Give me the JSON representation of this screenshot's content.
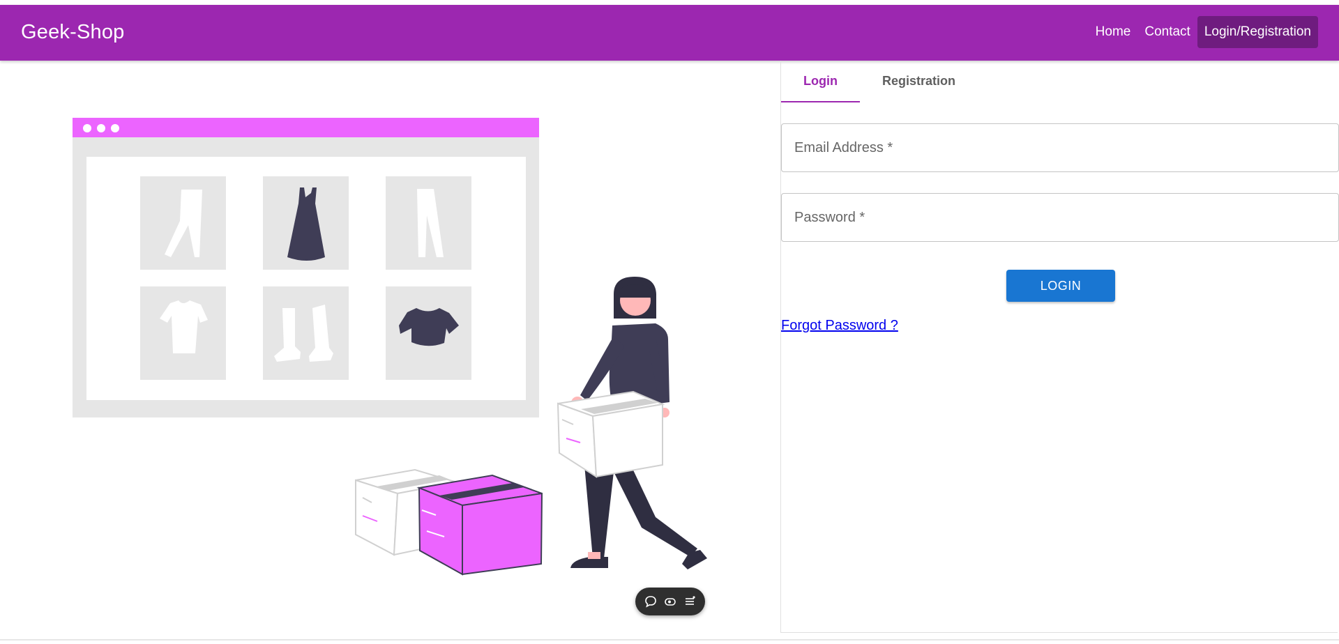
{
  "header": {
    "brand": "Geek-Shop",
    "nav": [
      {
        "label": "Home"
      },
      {
        "label": "Contact"
      },
      {
        "label": "Login/Registration"
      }
    ]
  },
  "auth": {
    "tabs": [
      {
        "label": "Login"
      },
      {
        "label": "Registration"
      }
    ],
    "email": {
      "placeholder": "Email Address *",
      "value": ""
    },
    "password": {
      "placeholder": "Password *",
      "value": ""
    },
    "login_button": "LOGIN",
    "forgot_link": "Forgot Password ?"
  },
  "colors": {
    "appbar": "#9c27b0",
    "active_nav": "#6f1c7f",
    "accent_pink": "#ec64ff",
    "button": "#1976d2",
    "dark_figure": "#3f3d56"
  },
  "icons": {
    "toolbar": [
      "chat-bubble-icon",
      "eye-icon",
      "menu-list-icon"
    ]
  }
}
